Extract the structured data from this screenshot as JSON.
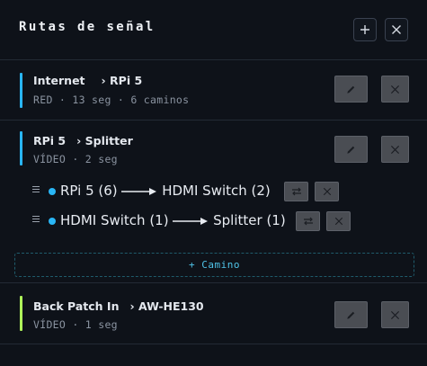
{
  "header": {
    "title": "Rutas de señal",
    "add_icon": "plus-icon",
    "close_icon": "close-icon"
  },
  "routes": [
    {
      "source": "Internet",
      "arrow": "›",
      "target": "RPi 5",
      "meta": "RED · 13 seg · 6 caminos",
      "color": "#29b6f6"
    },
    {
      "source": "RPi 5",
      "arrow": "›",
      "target": "Splitter",
      "meta": "VÍDEO · 2 seg",
      "color": "#29b6f6",
      "steps": [
        {
          "from": "RPi 5 (6)",
          "to": "HDMI Switch (2)"
        },
        {
          "from": "HDMI Switch (1)",
          "to": "Splitter (1)"
        }
      ],
      "add_label": "+ Camino"
    },
    {
      "source": "Back Patch In",
      "arrow": "›",
      "target": "AW-HE130",
      "meta": "VÍDEO · 1 seg",
      "color": "#aef25a"
    }
  ],
  "icons": {
    "edit": "pencil-icon",
    "delete": "close-icon",
    "swap": "swap-icon",
    "drag": "drag-handle-icon"
  }
}
